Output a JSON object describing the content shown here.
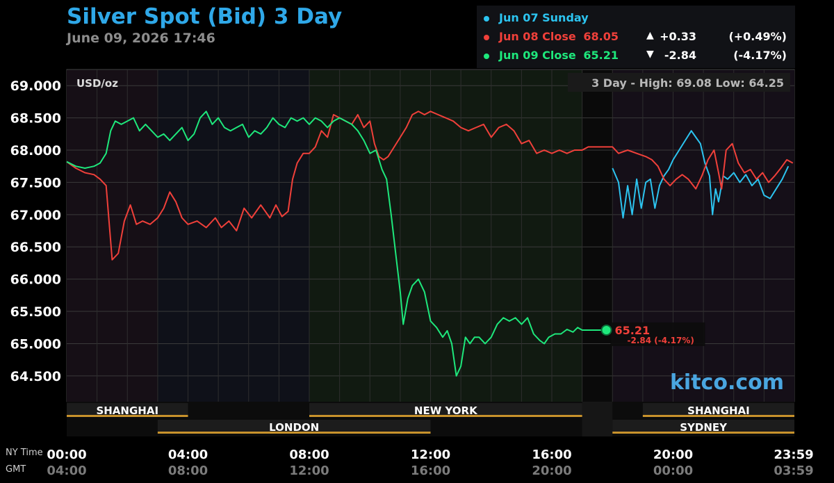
{
  "header": {
    "title": "Silver Spot (Bid) 3 Day",
    "datetime": "June 09, 2026 17:46"
  },
  "legend": [
    {
      "label": "Jun 07 Sunday",
      "color": "#2cc4f0",
      "value": "",
      "arrow": "",
      "change": "",
      "percent": ""
    },
    {
      "label": "Jun 08 Close",
      "color": "#f0403a",
      "value": "68.05",
      "arrow": "▲",
      "change": "+0.33",
      "percent": "(+0.49%)"
    },
    {
      "label": "Jun 09 Close",
      "color": "#1ee87c",
      "value": "65.21",
      "arrow": "▼",
      "change": "-2.84",
      "percent": "(-4.17%)"
    }
  ],
  "range_box": {
    "text": "3 Day - High: 69.08  Low: 64.25"
  },
  "watermark": "kitco.com",
  "last_price": {
    "value": "65.21",
    "change": "-2.84 (-4.17%)",
    "color": "#f0403a"
  },
  "chart_data": {
    "type": "line",
    "ylabel": "USD/oz",
    "ylim": [
      64.1,
      69.25
    ],
    "y_ticks": [
      69.0,
      68.5,
      68.0,
      67.5,
      67.0,
      66.5,
      66.0,
      65.5,
      65.0,
      64.5
    ],
    "y_tick_labels": [
      "69.000",
      "68.500",
      "68.000",
      "67.500",
      "67.000",
      "66.500",
      "66.000",
      "65.500",
      "65.000",
      "64.500"
    ],
    "xlim_hours": [
      0,
      24
    ],
    "x_tick_hours": [
      0,
      4,
      8,
      12,
      16,
      20,
      24
    ],
    "x_ticks_ny": [
      "00:00",
      "04:00",
      "08:00",
      "12:00",
      "16:00",
      "20:00",
      "23:59"
    ],
    "x_ticks_gmt": [
      "04:00",
      "08:00",
      "12:00",
      "16:00",
      "20:00",
      "00:00",
      "03:59"
    ],
    "x_row_labels": [
      "NY Time",
      "GMT"
    ],
    "series": [
      {
        "name": "Jun 07 Sunday",
        "color": "#2cc4f0",
        "points": [
          [
            18.0,
            67.72
          ],
          [
            18.2,
            67.5
          ],
          [
            18.35,
            66.95
          ],
          [
            18.5,
            67.45
          ],
          [
            18.65,
            67.0
          ],
          [
            18.8,
            67.55
          ],
          [
            18.95,
            67.1
          ],
          [
            19.1,
            67.5
          ],
          [
            19.25,
            67.55
          ],
          [
            19.4,
            67.1
          ],
          [
            19.55,
            67.45
          ],
          [
            19.7,
            67.6
          ],
          [
            19.85,
            67.7
          ],
          [
            20.0,
            67.85
          ],
          [
            20.2,
            68.0
          ],
          [
            20.4,
            68.15
          ],
          [
            20.6,
            68.3
          ],
          [
            20.75,
            68.2
          ],
          [
            20.9,
            68.1
          ],
          [
            21.05,
            67.8
          ],
          [
            21.2,
            67.6
          ],
          [
            21.3,
            67.0
          ],
          [
            21.4,
            67.4
          ],
          [
            21.5,
            67.2
          ],
          [
            21.65,
            67.6
          ],
          [
            21.8,
            67.55
          ],
          [
            22.0,
            67.65
          ],
          [
            22.2,
            67.5
          ],
          [
            22.4,
            67.62
          ],
          [
            22.6,
            67.45
          ],
          [
            22.8,
            67.55
          ],
          [
            23.0,
            67.3
          ],
          [
            23.2,
            67.25
          ],
          [
            23.4,
            67.4
          ],
          [
            23.6,
            67.55
          ],
          [
            23.8,
            67.75
          ]
        ]
      },
      {
        "name": "Jun 08 Close",
        "color": "#f0403a",
        "points": [
          [
            0.0,
            67.82
          ],
          [
            0.3,
            67.72
          ],
          [
            0.6,
            67.65
          ],
          [
            0.9,
            67.62
          ],
          [
            1.1,
            67.55
          ],
          [
            1.3,
            67.45
          ],
          [
            1.5,
            66.3
          ],
          [
            1.7,
            66.4
          ],
          [
            1.9,
            66.9
          ],
          [
            2.1,
            67.15
          ],
          [
            2.3,
            66.85
          ],
          [
            2.5,
            66.9
          ],
          [
            2.75,
            66.85
          ],
          [
            3.0,
            66.95
          ],
          [
            3.2,
            67.1
          ],
          [
            3.4,
            67.35
          ],
          [
            3.6,
            67.2
          ],
          [
            3.8,
            66.95
          ],
          [
            4.0,
            66.85
          ],
          [
            4.3,
            66.9
          ],
          [
            4.6,
            66.8
          ],
          [
            4.9,
            66.95
          ],
          [
            5.1,
            66.8
          ],
          [
            5.35,
            66.9
          ],
          [
            5.6,
            66.75
          ],
          [
            5.85,
            67.1
          ],
          [
            6.1,
            66.95
          ],
          [
            6.4,
            67.15
          ],
          [
            6.7,
            66.95
          ],
          [
            6.9,
            67.15
          ],
          [
            7.1,
            66.97
          ],
          [
            7.3,
            67.05
          ],
          [
            7.45,
            67.55
          ],
          [
            7.6,
            67.8
          ],
          [
            7.8,
            67.95
          ],
          [
            8.0,
            67.95
          ],
          [
            8.2,
            68.05
          ],
          [
            8.4,
            68.3
          ],
          [
            8.6,
            68.2
          ],
          [
            8.8,
            68.55
          ],
          [
            9.0,
            68.5
          ],
          [
            9.2,
            68.45
          ],
          [
            9.4,
            68.4
          ],
          [
            9.6,
            68.55
          ],
          [
            9.8,
            68.35
          ],
          [
            10.0,
            68.45
          ],
          [
            10.15,
            68.1
          ],
          [
            10.3,
            67.9
          ],
          [
            10.45,
            67.85
          ],
          [
            10.6,
            67.9
          ],
          [
            10.8,
            68.05
          ],
          [
            11.0,
            68.2
          ],
          [
            11.2,
            68.35
          ],
          [
            11.4,
            68.55
          ],
          [
            11.6,
            68.6
          ],
          [
            11.8,
            68.55
          ],
          [
            12.0,
            68.6
          ],
          [
            12.25,
            68.55
          ],
          [
            12.5,
            68.5
          ],
          [
            12.75,
            68.45
          ],
          [
            13.0,
            68.35
          ],
          [
            13.25,
            68.3
          ],
          [
            13.5,
            68.35
          ],
          [
            13.75,
            68.4
          ],
          [
            14.0,
            68.2
          ],
          [
            14.25,
            68.35
          ],
          [
            14.5,
            68.4
          ],
          [
            14.75,
            68.3
          ],
          [
            15.0,
            68.1
          ],
          [
            15.25,
            68.15
          ],
          [
            15.5,
            67.95
          ],
          [
            15.75,
            68.0
          ],
          [
            16.0,
            67.95
          ],
          [
            16.25,
            68.0
          ],
          [
            16.5,
            67.95
          ],
          [
            16.75,
            68.0
          ],
          [
            17.0,
            68.0
          ],
          [
            17.2,
            68.05
          ],
          [
            18.0,
            68.05
          ],
          [
            18.2,
            67.95
          ],
          [
            18.5,
            68.0
          ],
          [
            18.8,
            67.95
          ],
          [
            19.1,
            67.9
          ],
          [
            19.3,
            67.85
          ],
          [
            19.5,
            67.75
          ],
          [
            19.7,
            67.55
          ],
          [
            19.9,
            67.45
          ],
          [
            20.1,
            67.55
          ],
          [
            20.3,
            67.62
          ],
          [
            20.5,
            67.55
          ],
          [
            20.75,
            67.4
          ],
          [
            20.95,
            67.6
          ],
          [
            21.15,
            67.85
          ],
          [
            21.35,
            68.0
          ],
          [
            21.5,
            67.65
          ],
          [
            21.6,
            67.4
          ],
          [
            21.75,
            68.0
          ],
          [
            21.95,
            68.1
          ],
          [
            22.15,
            67.8
          ],
          [
            22.35,
            67.65
          ],
          [
            22.55,
            67.7
          ],
          [
            22.75,
            67.55
          ],
          [
            22.95,
            67.65
          ],
          [
            23.15,
            67.5
          ],
          [
            23.35,
            67.6
          ],
          [
            23.55,
            67.72
          ],
          [
            23.75,
            67.85
          ],
          [
            23.95,
            67.8
          ]
        ]
      },
      {
        "name": "Jun 09 Close",
        "color": "#1ee87c",
        "points": [
          [
            0.0,
            67.82
          ],
          [
            0.3,
            67.75
          ],
          [
            0.6,
            67.72
          ],
          [
            0.9,
            67.75
          ],
          [
            1.1,
            67.8
          ],
          [
            1.3,
            67.95
          ],
          [
            1.45,
            68.3
          ],
          [
            1.6,
            68.45
          ],
          [
            1.8,
            68.4
          ],
          [
            2.0,
            68.45
          ],
          [
            2.2,
            68.5
          ],
          [
            2.4,
            68.3
          ],
          [
            2.6,
            68.4
          ],
          [
            2.8,
            68.3
          ],
          [
            3.0,
            68.2
          ],
          [
            3.2,
            68.25
          ],
          [
            3.4,
            68.15
          ],
          [
            3.6,
            68.25
          ],
          [
            3.8,
            68.35
          ],
          [
            4.0,
            68.15
          ],
          [
            4.2,
            68.25
          ],
          [
            4.4,
            68.5
          ],
          [
            4.6,
            68.6
          ],
          [
            4.8,
            68.4
          ],
          [
            5.0,
            68.5
          ],
          [
            5.2,
            68.35
          ],
          [
            5.4,
            68.3
          ],
          [
            5.6,
            68.35
          ],
          [
            5.8,
            68.4
          ],
          [
            6.0,
            68.2
          ],
          [
            6.2,
            68.3
          ],
          [
            6.4,
            68.25
          ],
          [
            6.6,
            68.35
          ],
          [
            6.8,
            68.5
          ],
          [
            7.0,
            68.4
          ],
          [
            7.2,
            68.35
          ],
          [
            7.4,
            68.5
          ],
          [
            7.6,
            68.45
          ],
          [
            7.8,
            68.5
          ],
          [
            8.0,
            68.4
          ],
          [
            8.2,
            68.5
          ],
          [
            8.4,
            68.45
          ],
          [
            8.6,
            68.35
          ],
          [
            8.8,
            68.45
          ],
          [
            9.0,
            68.5
          ],
          [
            9.2,
            68.45
          ],
          [
            9.4,
            68.4
          ],
          [
            9.6,
            68.3
          ],
          [
            9.8,
            68.15
          ],
          [
            10.0,
            67.95
          ],
          [
            10.2,
            68.0
          ],
          [
            10.4,
            67.7
          ],
          [
            10.55,
            67.55
          ],
          [
            10.7,
            67.0
          ],
          [
            10.85,
            66.4
          ],
          [
            11.0,
            65.8
          ],
          [
            11.1,
            65.3
          ],
          [
            11.25,
            65.7
          ],
          [
            11.4,
            65.9
          ],
          [
            11.6,
            66.0
          ],
          [
            11.8,
            65.8
          ],
          [
            12.0,
            65.35
          ],
          [
            12.2,
            65.25
          ],
          [
            12.4,
            65.1
          ],
          [
            12.55,
            65.2
          ],
          [
            12.7,
            65.0
          ],
          [
            12.85,
            64.5
          ],
          [
            13.0,
            64.65
          ],
          [
            13.15,
            65.1
          ],
          [
            13.3,
            65.0
          ],
          [
            13.45,
            65.1
          ],
          [
            13.6,
            65.1
          ],
          [
            13.8,
            65.0
          ],
          [
            14.0,
            65.1
          ],
          [
            14.2,
            65.3
          ],
          [
            14.4,
            65.4
          ],
          [
            14.6,
            65.35
          ],
          [
            14.8,
            65.4
          ],
          [
            15.0,
            65.3
          ],
          [
            15.2,
            65.4
          ],
          [
            15.4,
            65.15
          ],
          [
            15.6,
            65.05
          ],
          [
            15.75,
            65.0
          ],
          [
            15.9,
            65.1
          ],
          [
            16.1,
            65.15
          ],
          [
            16.3,
            65.15
          ],
          [
            16.5,
            65.22
          ],
          [
            16.7,
            65.18
          ],
          [
            16.85,
            65.25
          ],
          [
            17.0,
            65.21
          ],
          [
            17.8,
            65.21
          ]
        ]
      }
    ],
    "sessions_top": [
      {
        "label": "SHANGHAI",
        "start": 0,
        "end": 4
      },
      {
        "label": "NEW YORK",
        "start": 8,
        "end": 17
      },
      {
        "label": "SHANGHAI",
        "start": 19,
        "end": 24
      }
    ],
    "sessions_bottom": [
      {
        "label": "LONDON",
        "start": 3,
        "end": 12
      },
      {
        "label": "SYDNEY",
        "start": 18,
        "end": 24
      }
    ],
    "background_bands": [
      {
        "start": 0,
        "end": 3,
        "color": "#160f16"
      },
      {
        "start": 3,
        "end": 8,
        "color": "#0f1119"
      },
      {
        "start": 8,
        "end": 17,
        "color": "#111a11"
      },
      {
        "start": 17,
        "end": 18,
        "color": "#0a0a0a"
      },
      {
        "start": 18,
        "end": 24,
        "color": "#150f18"
      }
    ]
  }
}
